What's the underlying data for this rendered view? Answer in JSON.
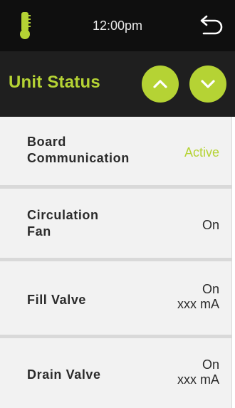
{
  "header": {
    "time": "12:00pm",
    "title": "Unit Status",
    "icons": {
      "status": "thermometer-icon",
      "back": "back-arrow-icon",
      "up": "chevron-up-icon",
      "down": "chevron-down-icon"
    }
  },
  "colors": {
    "accent": "#b5d334",
    "topbar": "#0f0f0f",
    "header": "#1f1f1f",
    "row_bg": "#f2f2f2",
    "divider": "#d9d9d9"
  },
  "rows": [
    {
      "label_lines": [
        "Board",
        "Communication"
      ],
      "value_lines": [
        "Active"
      ]
    },
    {
      "label_lines": [
        "Circulation",
        "Fan"
      ],
      "value_lines": [
        "On"
      ]
    },
    {
      "label_lines": [
        "Fill Valve"
      ],
      "value_lines": [
        "On",
        "xxx mA"
      ]
    },
    {
      "label_lines": [
        "Drain Valve"
      ],
      "value_lines": [
        "On",
        "xxx mA"
      ]
    }
  ]
}
